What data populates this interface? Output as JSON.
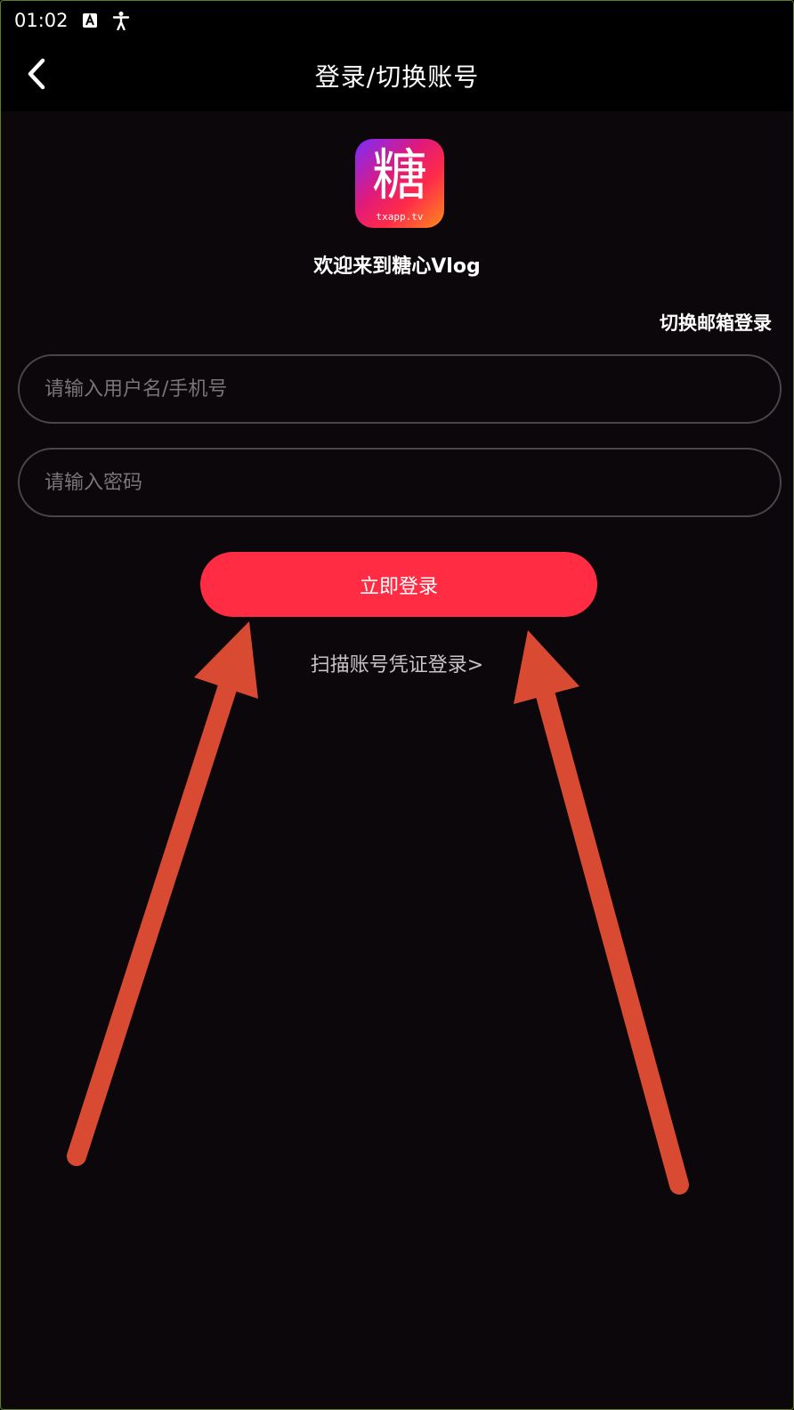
{
  "status_bar": {
    "time": "01:02",
    "icons": [
      "a-icon",
      "accessibility-icon"
    ]
  },
  "header": {
    "title": "登录/切换账号",
    "back_icon": "chevron-left-icon"
  },
  "logo": {
    "glyph": "糖",
    "subtext": "txapp.tv"
  },
  "welcome_text": "欢迎来到糖心Vlog",
  "switch_email_label": "切换邮箱登录",
  "form": {
    "username_placeholder": "请输入用户名/手机号",
    "password_placeholder": "请输入密码",
    "login_label": "立即登录"
  },
  "scan_link_label": "扫描账号凭证登录>",
  "colors": {
    "background": "#0b070a",
    "header": "#000000",
    "accent": "#ff2c44",
    "annotation_arrow": "#d94a32"
  }
}
